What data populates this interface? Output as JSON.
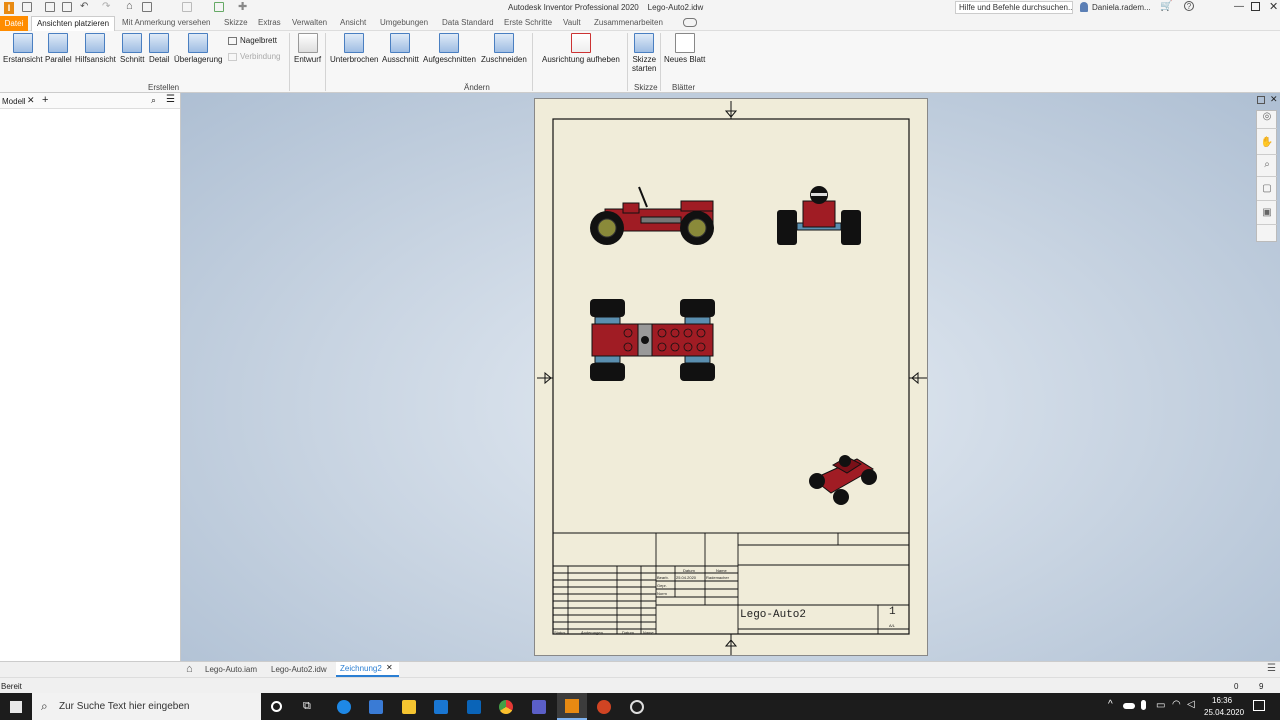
{
  "app": {
    "window_title": "Autodesk Inventor Professional 2020    Lego-Auto2.idw",
    "help_search": "Hilfe und Befehle durchsuchen...",
    "user": "Daniela.radem..."
  },
  "menu": {
    "tabs": [
      "Datei",
      "Ansichten platzieren",
      "Mit Anmerkung versehen",
      "Skizze",
      "Extras",
      "Verwalten",
      "Ansicht",
      "Umgebungen",
      "Data Standard",
      "Erste Schritte",
      "Vault",
      "Zusammenarbeiten"
    ]
  },
  "ribbon": {
    "create": [
      "Erstansicht",
      "Parallel",
      "Hilfsansicht",
      "Schnitt",
      "Detail",
      "Überlagerung"
    ],
    "nagelbrett": "Nagelbrett",
    "verbindung": "Verbindung",
    "entwurf": "Entwurf",
    "modify": [
      "Unterbrochen",
      "Ausschnitt",
      "Aufgeschnitten",
      "Zuschneiden"
    ],
    "ausrichtung": "Ausrichtung aufheben",
    "skizze_starten_1": "Skizze",
    "skizze_starten_2": "starten",
    "neues_blatt": "Neues Blatt",
    "groups": {
      "erstellen": "Erstellen",
      "aendern": "Ändern",
      "skizze": "Skizze",
      "blaetter": "Blätter"
    }
  },
  "panel": {
    "title": "Modell"
  },
  "drawing": {
    "part_name": "Lego-Auto2",
    "sheet_number": "1",
    "sheet_sub": "A/L",
    "tb": {
      "datum": "Datum",
      "name": "Name",
      "bearb": "Bearb.",
      "datum_val": "25.04.2020",
      "name_val": "Rademacher",
      "gepr": "Gepr.",
      "norm": "Norm",
      "status": "Status",
      "aenderungen": "Änderungen",
      "datum2": "Datum",
      "name2": "Name"
    }
  },
  "doctabs": [
    "Lego-Auto.iam",
    "Lego-Auto2.idw",
    "Zeichnung2"
  ],
  "status": {
    "text": "Bereit",
    "count1": "0",
    "count2": "9"
  },
  "taskbar": {
    "search": "Zur Suche Text hier eingeben",
    "time": "16:36",
    "date": "25.04.2020"
  },
  "colors": {
    "accent": "#ff8c00",
    "car_red": "#a01c24",
    "sheet": "#f0ecd9"
  }
}
